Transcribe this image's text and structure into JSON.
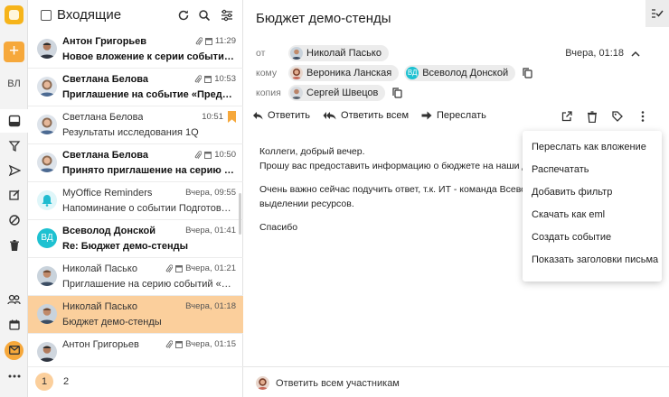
{
  "rail": {
    "user_initials": "ВЛ",
    "compose_label": "+"
  },
  "list": {
    "title": "Входящие",
    "pages": [
      "1",
      "2"
    ],
    "items": [
      {
        "name": "Антон Григорьев",
        "time": "11:29",
        "subject": "Новое вложение к серии событий «Аналитическ...",
        "unread": true,
        "avatar": "photo-man-dark",
        "attach": true,
        "cal": true
      },
      {
        "name": "Светлана Белова",
        "time": "10:53",
        "subject": "Приглашение на событие «Предварительное о...",
        "unread": true,
        "avatar": "photo-woman",
        "attach": true,
        "cal": true
      },
      {
        "name": "Светлана Белова",
        "time": "10:51",
        "subject": "Результаты исследования 1Q",
        "unread": false,
        "avatar": "photo-woman",
        "attach": false,
        "cal": false,
        "flag": true
      },
      {
        "name": "Светлана Белова",
        "time": "10:50",
        "subject": "Принято приглашение на серию событий",
        "unread": true,
        "avatar": "photo-woman",
        "attach": true,
        "cal": true
      },
      {
        "name": "MyOffice Reminders",
        "time": "Вчера, 09:55",
        "subject": "Напоминание о событии Подготовить отчет о...",
        "unread": false,
        "avatar": "bell",
        "attach": false,
        "cal": false
      },
      {
        "name": "Всеволод Донской",
        "time": "Вчера, 01:41",
        "subject": "Re: Бюджет демо-стенды",
        "unread": true,
        "avatar": "initials",
        "initials": "ВД",
        "attach": false,
        "cal": false
      },
      {
        "name": "Николай Пасько",
        "time": "Вчера, 01:21",
        "subject": "Приглашение на серию событий «Демо стенд...",
        "unread": false,
        "avatar": "photo-man",
        "attach": true,
        "cal": true
      },
      {
        "name": "Николай Пасько",
        "time": "Вчера, 01:18",
        "subject": "Бюджет демо-стенды",
        "unread": false,
        "avatar": "photo-man",
        "attach": false,
        "cal": false,
        "selected": true
      },
      {
        "name": "Антон Григорьев",
        "time": "Вчера, 01:15",
        "subject": "",
        "unread": false,
        "avatar": "photo-man-dark",
        "attach": true,
        "cal": true
      }
    ]
  },
  "letter": {
    "subject": "Бюджет демо-стенды",
    "from_label": "от",
    "to_label": "кому",
    "cc_label": "копия",
    "from": "Николай Пасько",
    "to": [
      {
        "name": "Вероника Ланская",
        "initials": ""
      },
      {
        "name": "Всеволод Донской",
        "initials": "ВД"
      }
    ],
    "cc": "Сергей Швецов",
    "date": "Вчера, 01:18",
    "actions": {
      "reply": "Ответить",
      "reply_all": "Ответить всем",
      "forward": "Переслать"
    },
    "body": [
      "Коллеги, добрый вечер.",
      "Прошу вас предоставить информацию о бюджете на наши демонстрац",
      "",
      "Очень важно сейчас подучить ответ, т.к. ИТ - команда Всеволода, уже",
      "выделении ресурсов.",
      "",
      "Спасибо"
    ],
    "reply_placeholder": "Ответить всем участникам"
  },
  "menu": {
    "items": [
      "Переслать как вложение",
      "Распечатать",
      "Добавить фильтр",
      "Скачать как eml",
      "Создать событие",
      "Показать заголовки письма"
    ]
  }
}
